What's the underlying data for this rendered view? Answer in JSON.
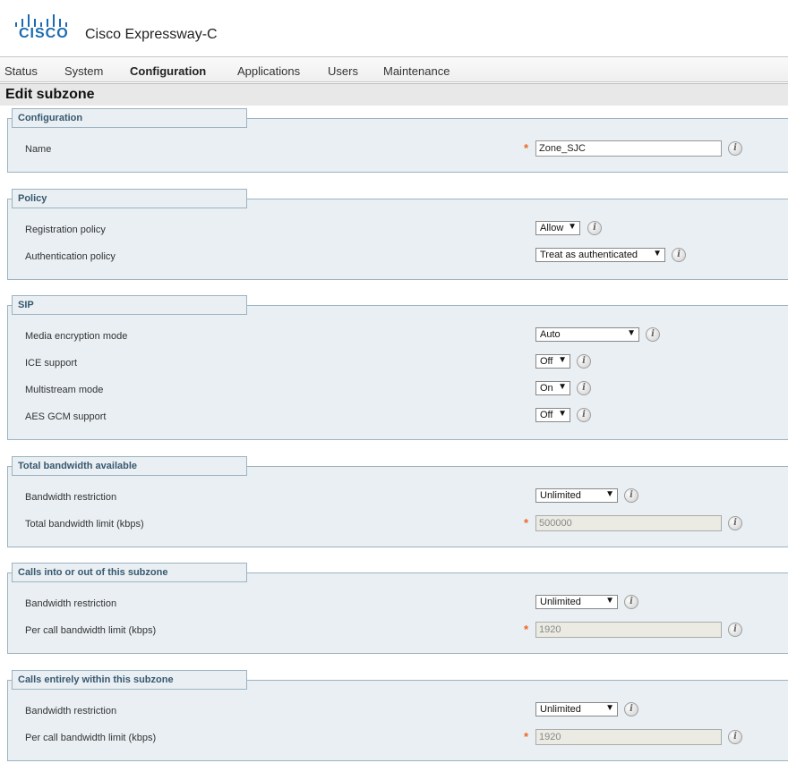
{
  "header": {
    "logo_text": "CISCO",
    "product": "Cisco Expressway-C"
  },
  "nav": {
    "items": [
      "Status",
      "System",
      "Configuration",
      "Applications",
      "Users",
      "Maintenance"
    ],
    "active": "Configuration"
  },
  "page_title": "Edit subzone",
  "sections": {
    "configuration": {
      "title": "Configuration",
      "name_label": "Name",
      "name_value": "Zone_SJC"
    },
    "policy": {
      "title": "Policy",
      "registration_label": "Registration policy",
      "registration_value": "Allow",
      "authentication_label": "Authentication policy",
      "authentication_value": "Treat as authenticated"
    },
    "sip": {
      "title": "SIP",
      "media_label": "Media encryption mode",
      "media_value": "Auto",
      "ice_label": "ICE support",
      "ice_value": "Off",
      "multistream_label": "Multistream mode",
      "multistream_value": "On",
      "aes_label": "AES GCM support",
      "aes_value": "Off"
    },
    "total_bandwidth": {
      "title": "Total bandwidth available",
      "restriction_label": "Bandwidth restriction",
      "restriction_value": "Unlimited",
      "limit_label": "Total bandwidth limit (kbps)",
      "limit_value": "500000"
    },
    "calls_into_out": {
      "title": "Calls into or out of this subzone",
      "restriction_label": "Bandwidth restriction",
      "restriction_value": "Unlimited",
      "limit_label": "Per call bandwidth limit (kbps)",
      "limit_value": "1920"
    },
    "calls_within": {
      "title": "Calls entirely within this subzone",
      "restriction_label": "Bandwidth restriction",
      "restriction_value": "Unlimited",
      "limit_label": "Per call bandwidth limit (kbps)",
      "limit_value": "1920"
    }
  },
  "icons": {
    "info": "i",
    "dropdown_arrow": "▼",
    "required": "*"
  },
  "colors": {
    "cisco_blue": "#1a6bb1",
    "section_bg": "#e9eff3",
    "section_border": "#9cb3c2",
    "section_title": "#37586f",
    "required_star": "#f26522"
  }
}
